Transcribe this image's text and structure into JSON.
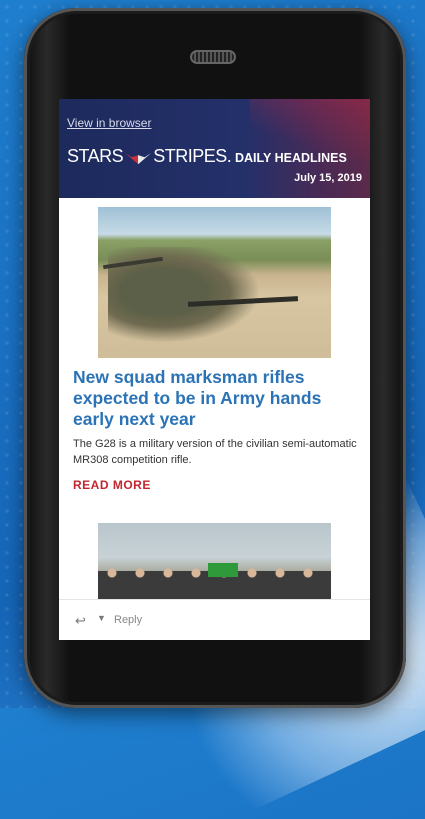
{
  "header": {
    "view_in_browser": "View in browser",
    "logo_left": "STARS",
    "logo_right": "STRIPES.",
    "section": "DAILY HEADLINES",
    "date": "July 15, 2019"
  },
  "article": {
    "headline": "New squad marksman rifles expected to be in Army hands early next year",
    "summary": "The G28 is a military version of the civilian semi-automatic MR308 competition rifle.",
    "read_more": "READ MORE"
  },
  "reply_bar": {
    "reply_icon": "reply-icon",
    "reply_label": "Reply"
  },
  "colors": {
    "header_bg": "#1d2a5c",
    "headline": "#2b73b5",
    "read_more": "#c4262e",
    "phone_bg": "#1a6fc2"
  }
}
